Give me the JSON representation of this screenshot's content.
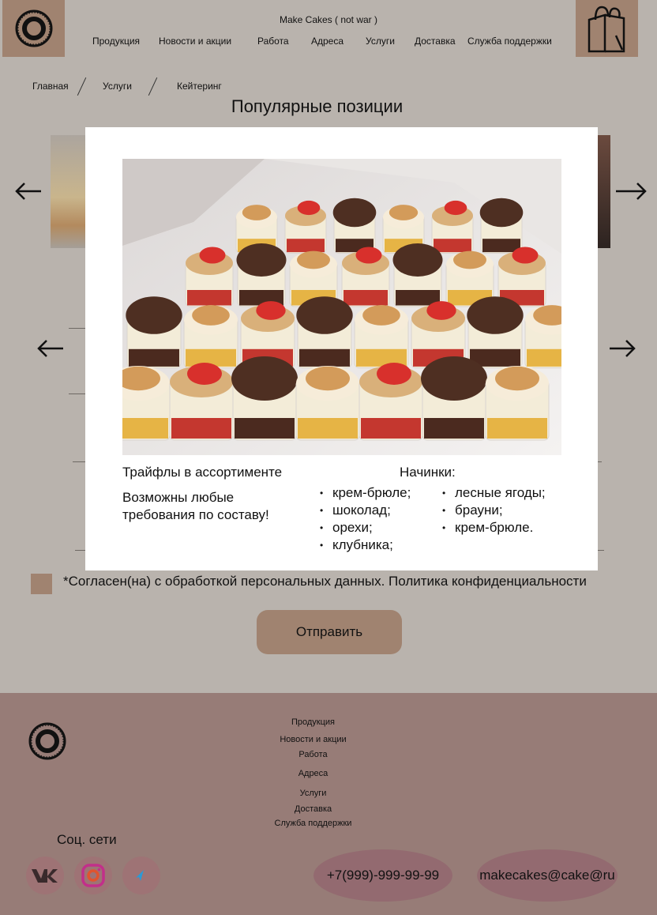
{
  "header": {
    "brand": "Make Cakes ( not war )",
    "nav": [
      "Продукция",
      "Новости и акции",
      "Работа",
      "Адреса",
      "Услуги",
      "Доставка",
      "Служба поддержки"
    ]
  },
  "breadcrumb": [
    "Главная",
    "Услуги",
    "Кейтеринг"
  ],
  "page_title": "Популярные позиции",
  "modal": {
    "title": "Трайфлы в ассортименте",
    "description": "Возможны любые требования по составу!",
    "fillings_title": "Начинки:",
    "fillings_col1": [
      "крем-брюле;",
      "шоколад;",
      "орехи;",
      "клубника;"
    ],
    "fillings_col2": [
      "лесные ягоды;",
      "брауни;",
      "крем-брюле."
    ]
  },
  "form": {
    "consent": "*Согласен(на) с обработкой персональных данных. Политика конфиденциальности",
    "submit": "Отправить"
  },
  "footer": {
    "links": [
      "Продукция",
      "Новости и акции",
      "Работа",
      "Адреса",
      "Услуги",
      "Доставка",
      "Служба поддержки"
    ],
    "social_label": "Соц. сети",
    "phone": "+7(999)-999-99-99",
    "email": "makecakes@cake@ru"
  },
  "colors": {
    "accent": "#a08370",
    "page_dim": "#b9b3ad",
    "footer": "#977c77"
  },
  "icons": [
    "logo-icon",
    "shopping-bag-icon",
    "arrow-left-icon",
    "arrow-right-icon",
    "vk-icon",
    "instagram-icon",
    "telegram-icon"
  ]
}
